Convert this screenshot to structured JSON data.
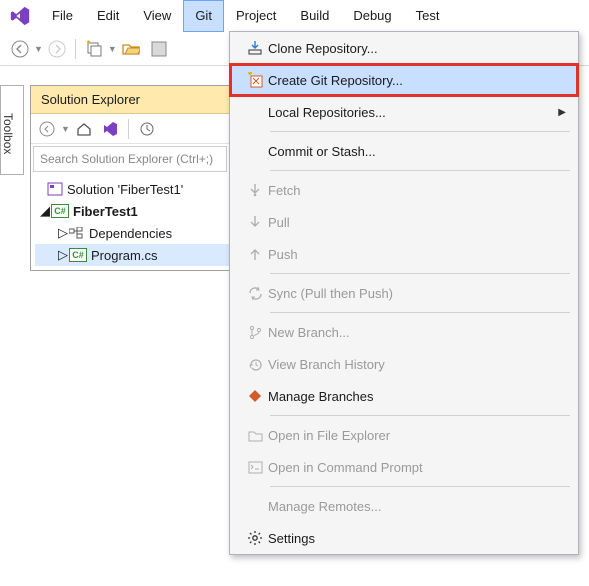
{
  "menubar": {
    "items": [
      "File",
      "Edit",
      "View",
      "Git",
      "Project",
      "Build",
      "Debug",
      "Test"
    ],
    "active_index": 3
  },
  "toolbox_tab": "Toolbox",
  "solution_explorer": {
    "title": "Solution Explorer",
    "search_placeholder": "Search Solution Explorer (Ctrl+;)",
    "solution_label": "Solution 'FiberTest1'",
    "project_label": "FiberTest1",
    "dependencies_label": "Dependencies",
    "program_label": "Program.cs"
  },
  "git_menu": {
    "items": [
      {
        "label": "Clone Repository...",
        "enabled": true,
        "icon": "clone"
      },
      {
        "label": "Create Git Repository...",
        "enabled": true,
        "icon": "create",
        "highlighted": true
      },
      {
        "label": "Local Repositories...",
        "enabled": true,
        "icon": "",
        "submenu": true
      },
      {
        "sep": true
      },
      {
        "label": "Commit or Stash...",
        "enabled": true,
        "icon": ""
      },
      {
        "sep": true
      },
      {
        "label": "Fetch",
        "enabled": false,
        "icon": "fetch"
      },
      {
        "label": "Pull",
        "enabled": false,
        "icon": "pull"
      },
      {
        "label": "Push",
        "enabled": false,
        "icon": "push"
      },
      {
        "sep": true
      },
      {
        "label": "Sync (Pull then Push)",
        "enabled": false,
        "icon": "sync"
      },
      {
        "sep": true
      },
      {
        "label": "New Branch...",
        "enabled": false,
        "icon": "branch"
      },
      {
        "label": "View Branch History",
        "enabled": false,
        "icon": "history"
      },
      {
        "label": "Manage Branches",
        "enabled": true,
        "icon": "manage"
      },
      {
        "sep": true
      },
      {
        "label": "Open in File Explorer",
        "enabled": false,
        "icon": "folder"
      },
      {
        "label": "Open in Command Prompt",
        "enabled": false,
        "icon": "terminal"
      },
      {
        "sep": true
      },
      {
        "label": "Manage Remotes...",
        "enabled": false,
        "icon": ""
      },
      {
        "label": "Settings",
        "enabled": true,
        "icon": "gear"
      }
    ]
  }
}
